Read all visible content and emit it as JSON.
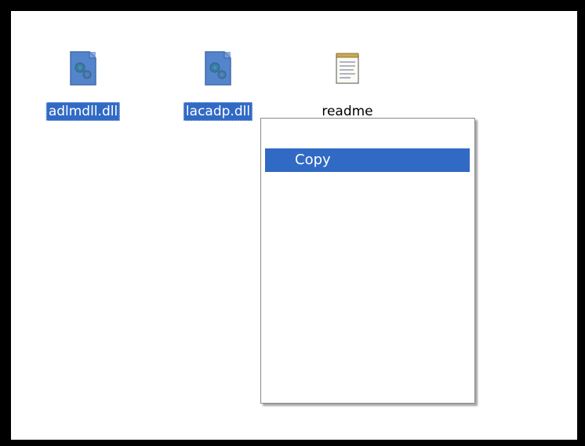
{
  "desktop": {
    "files": [
      {
        "name": "adlmdll.dll",
        "icon": "dll-file-icon",
        "selected": true
      },
      {
        "name": "lacadp.dll",
        "icon": "dll-file-icon",
        "selected": true
      },
      {
        "name": "readme",
        "icon": "text-document-icon",
        "selected": false
      }
    ]
  },
  "context_menu": {
    "items": [
      {
        "label": "Copy",
        "highlighted": true
      }
    ]
  },
  "colors": {
    "selection": "#316ac5",
    "frame": "#000000",
    "background": "#ffffff"
  }
}
